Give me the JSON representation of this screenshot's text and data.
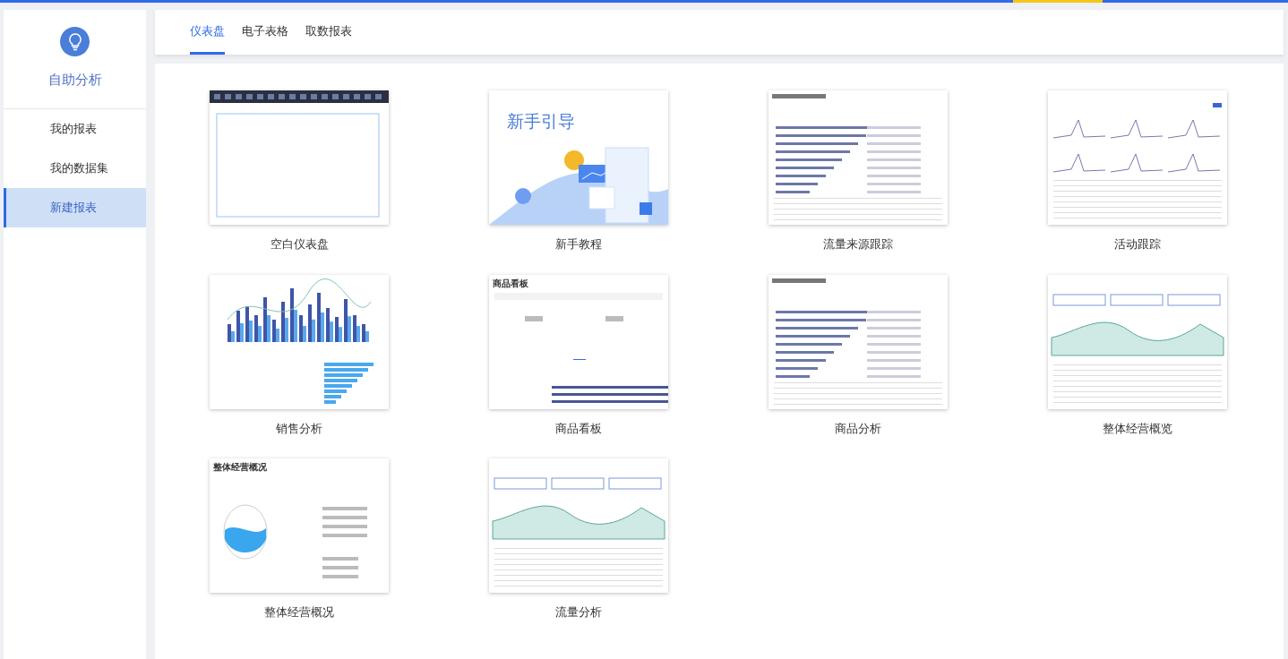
{
  "sidebar": {
    "title": "自助分析",
    "items": [
      {
        "label": "我的报表",
        "selected": false
      },
      {
        "label": "我的数据集",
        "selected": false
      },
      {
        "label": "新建报表",
        "selected": true
      }
    ]
  },
  "tabs": [
    {
      "label": "仪表盘",
      "selected": true
    },
    {
      "label": "电子表格",
      "selected": false
    },
    {
      "label": "取数报表",
      "selected": false
    }
  ],
  "templates": [
    {
      "name": "空白仪表盘",
      "kind": "blank"
    },
    {
      "name": "新手教程",
      "kind": "guide",
      "preview_title": "新手引导"
    },
    {
      "name": "流量来源跟踪",
      "kind": "bars-list"
    },
    {
      "name": "活动跟踪",
      "kind": "line-grid"
    },
    {
      "name": "销售分析",
      "kind": "bar-chart"
    },
    {
      "name": "商品看板",
      "kind": "board",
      "preview_title": "商品看板"
    },
    {
      "name": "商品分析",
      "kind": "bars-list"
    },
    {
      "name": "整体经营概览",
      "kind": "area"
    },
    {
      "name": "整体经营概况",
      "kind": "overview",
      "preview_title": "整体经营概况"
    },
    {
      "name": "流量分析",
      "kind": "area"
    }
  ]
}
